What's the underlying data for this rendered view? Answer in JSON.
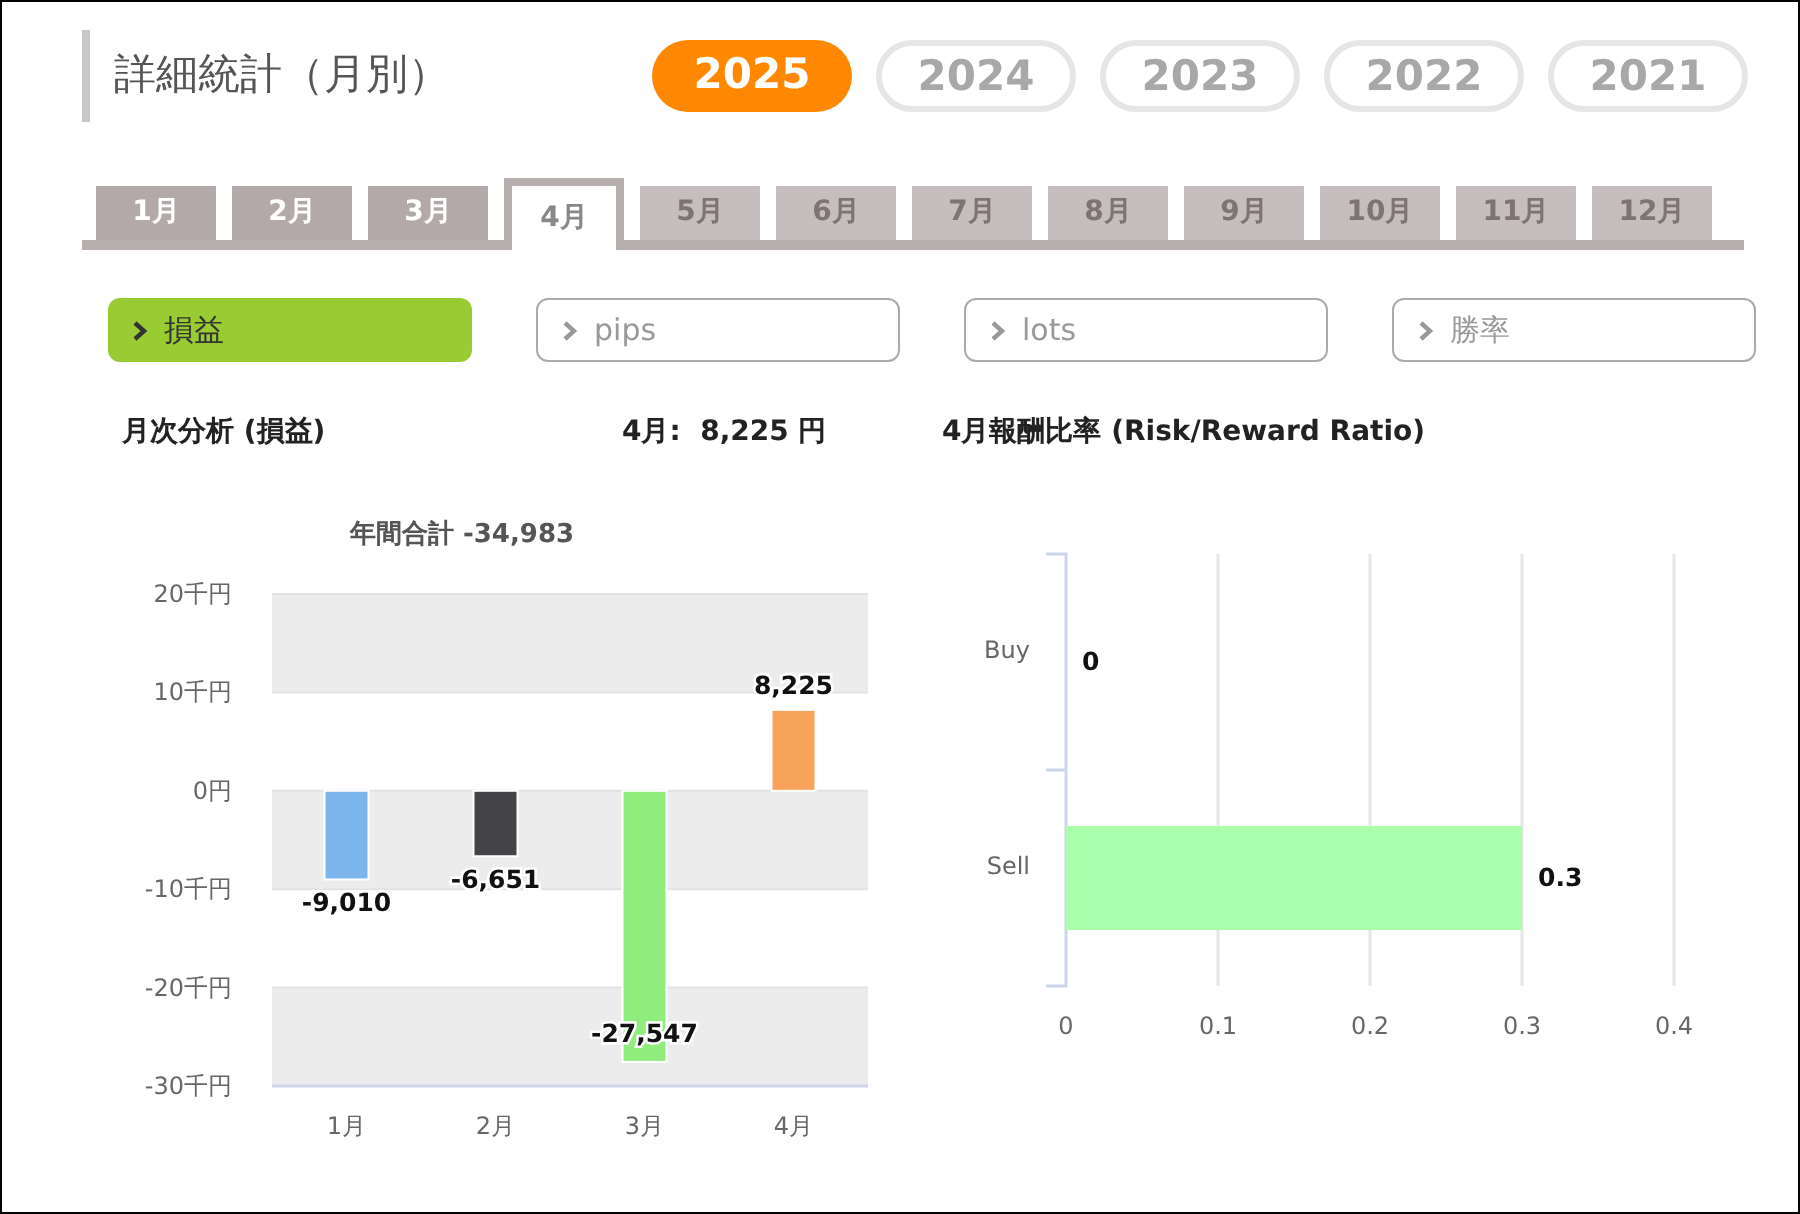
{
  "page_title": "詳細統計（月別）",
  "years": [
    {
      "label": "2025",
      "selected": true
    },
    {
      "label": "2024",
      "selected": false
    },
    {
      "label": "2023",
      "selected": false
    },
    {
      "label": "2022",
      "selected": false
    },
    {
      "label": "2021",
      "selected": false
    }
  ],
  "month_tabs": [
    {
      "label": "1月",
      "selected": false,
      "disabled": false
    },
    {
      "label": "2月",
      "selected": false,
      "disabled": false
    },
    {
      "label": "3月",
      "selected": false,
      "disabled": false
    },
    {
      "label": "4月",
      "selected": true,
      "disabled": false
    },
    {
      "label": "5月",
      "selected": false,
      "disabled": true
    },
    {
      "label": "6月",
      "selected": false,
      "disabled": true
    },
    {
      "label": "7月",
      "selected": false,
      "disabled": true
    },
    {
      "label": "8月",
      "selected": false,
      "disabled": true
    },
    {
      "label": "9月",
      "selected": false,
      "disabled": true
    },
    {
      "label": "10月",
      "selected": false,
      "disabled": true
    },
    {
      "label": "11月",
      "selected": false,
      "disabled": true
    },
    {
      "label": "12月",
      "selected": false,
      "disabled": true
    }
  ],
  "metrics": [
    {
      "label": "損益",
      "selected": true
    },
    {
      "label": "pips",
      "selected": false
    },
    {
      "label": "lots",
      "selected": false
    },
    {
      "label": "勝率",
      "selected": false
    }
  ],
  "monthly_panel": {
    "heading": "月次分析 (損益)",
    "summary": "4月:  8,225 円",
    "chart_data": {
      "type": "bar",
      "title": "年間合計 -34,983",
      "categories": [
        "1月",
        "2月",
        "3月",
        "4月"
      ],
      "series": [
        {
          "color": "#7cb5ec",
          "values": [
            -9.01,
            null,
            null,
            null
          ]
        },
        {
          "color": "#434348",
          "values": [
            null,
            -6.651,
            null,
            null
          ]
        },
        {
          "color": "#90ed7d",
          "values": [
            null,
            null,
            -27.547,
            null
          ]
        },
        {
          "color": "#f7a35c",
          "values": [
            null,
            null,
            null,
            8.225
          ]
        }
      ],
      "value_labels": [
        "-9,010",
        "-6,651",
        "-27,547",
        "8,225"
      ],
      "grid": true,
      "ylim": [
        -30,
        20
      ],
      "yticks": [
        {
          "value": 20,
          "label": "20千円"
        },
        {
          "value": 10,
          "label": "10千円"
        },
        {
          "value": 0,
          "label": "0円"
        },
        {
          "value": -10,
          "label": "-10千円"
        },
        {
          "value": -20,
          "label": "-20千円"
        },
        {
          "value": -30,
          "label": "-30千円"
        }
      ]
    }
  },
  "ratio_panel": {
    "heading": "4月報酬比率 (Risk/Reward Ratio)",
    "chart_data": {
      "type": "bar",
      "orientation": "horizontal",
      "categories": [
        "Buy",
        "Sell"
      ],
      "series": [
        {
          "color": "#aaffaa",
          "values": [
            0,
            0.3
          ]
        }
      ],
      "value_labels": [
        "0",
        "0.3"
      ],
      "grid": true,
      "xlim": [
        0,
        0.4
      ],
      "xticks": [
        0,
        0.1,
        0.2,
        0.3,
        0.4
      ]
    }
  }
}
